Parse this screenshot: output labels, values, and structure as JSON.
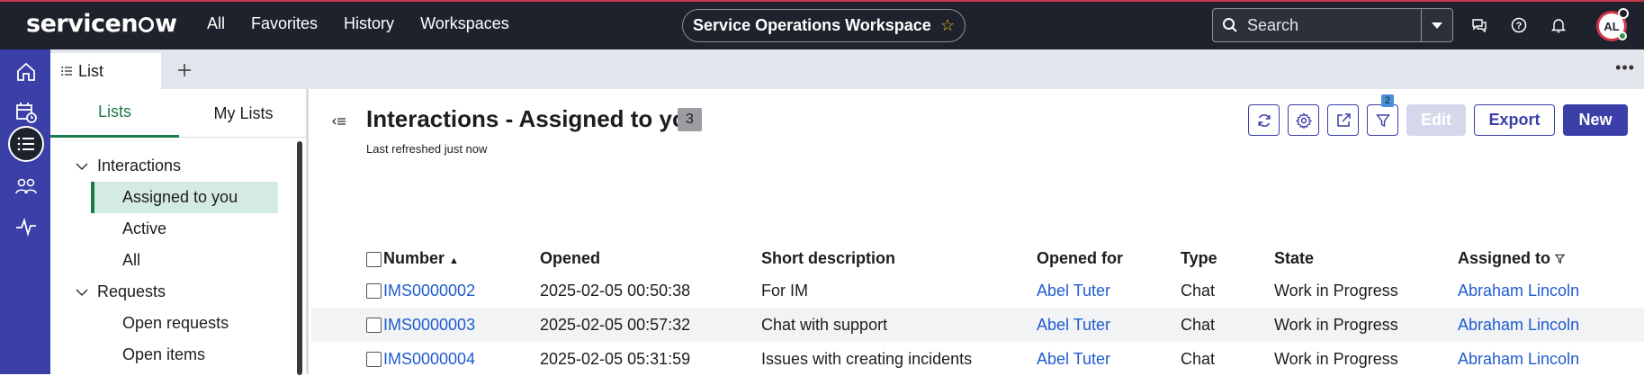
{
  "brand": {
    "logo_text": "servicenow"
  },
  "top_nav": [
    "All",
    "Favorites",
    "History",
    "Workspaces"
  ],
  "workspace": {
    "title": "Service Operations Workspace"
  },
  "search": {
    "placeholder": "Search"
  },
  "user": {
    "initials": "AL"
  },
  "tabbar": {
    "tab_label": "List"
  },
  "side": {
    "tabs": [
      "Lists",
      "My Lists"
    ],
    "groups": [
      {
        "label": "Interactions",
        "items": [
          "Assigned to you",
          "Active",
          "All"
        ]
      },
      {
        "label": "Requests",
        "items": [
          "Open requests",
          "Open items"
        ]
      }
    ]
  },
  "main": {
    "title": "Interactions - Assigned to you",
    "count": "3",
    "refreshed": "Last refreshed just now",
    "filter_badge": "2",
    "buttons": {
      "edit": "Edit",
      "export": "Export",
      "new": "New"
    }
  },
  "table": {
    "columns": [
      "Number",
      "Opened",
      "Short description",
      "Opened for",
      "Type",
      "State",
      "Assigned to"
    ],
    "rows": [
      [
        "IMS0000002",
        "2025-02-05 00:50:38",
        "For IM",
        "Abel Tuter",
        "Chat",
        "Work in Progress",
        "Abraham Lincoln"
      ],
      [
        "IMS0000003",
        "2025-02-05 00:57:32",
        "Chat with support",
        "Abel Tuter",
        "Chat",
        "Work in Progress",
        "Abraham Lincoln"
      ],
      [
        "IMS0000004",
        "2025-02-05 05:31:59",
        "Issues with creating incidents",
        "Abel Tuter",
        "Chat",
        "Work in Progress",
        "Abraham Lincoln"
      ]
    ]
  },
  "colors": {
    "topbar": "#1e222c",
    "rail": "#3b3fa8",
    "accent_green": "#1b7a4a",
    "link": "#1f5ccf"
  }
}
